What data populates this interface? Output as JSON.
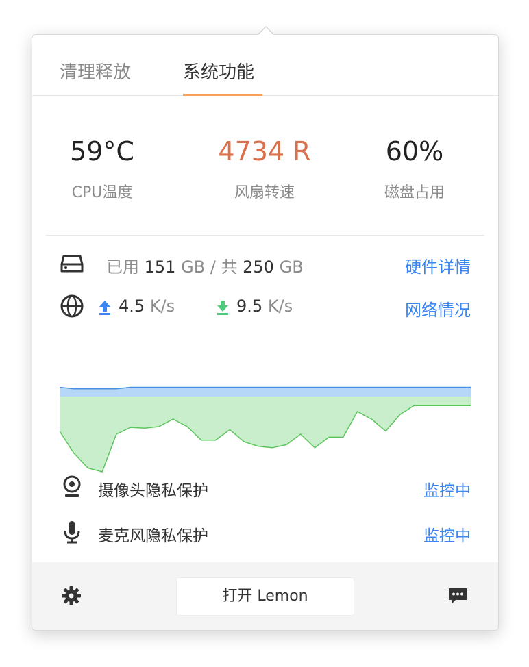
{
  "tabs": [
    {
      "label": "清理释放"
    },
    {
      "label": "系统功能"
    }
  ],
  "stats": {
    "cpu": {
      "value": "59°C",
      "label": "CPU温度"
    },
    "fan": {
      "value": "4734 R",
      "label": "风扇转速"
    },
    "disk": {
      "value": "60%",
      "label": "磁盘占用"
    }
  },
  "storage": {
    "used_prefix": "已用",
    "used_value": "151",
    "unit1": "GB / 共",
    "total_value": "250",
    "unit2": "GB",
    "link": "硬件详情"
  },
  "network": {
    "up_value": "4.5",
    "up_unit": "K/s",
    "down_value": "9.5",
    "down_unit": "K/s",
    "link": "网络情况"
  },
  "privacy": {
    "camera_label": "摄像头隐私保护",
    "camera_status": "监控中",
    "mic_label": "麦克风隐私保护",
    "mic_status": "监控中"
  },
  "footer": {
    "open_button": "打开 Lemon"
  },
  "colors": {
    "accent_orange": "#f4a25b",
    "fan_value": "#d9704b",
    "link_blue": "#3a86f2",
    "upload_blue": "#3a86f2",
    "download_green": "#4fc97a",
    "chart_blue_fill": "#b6d7f7",
    "chart_blue_line": "#4a90e2",
    "chart_green_fill": "#c9eecb",
    "chart_green_line": "#5cc45c"
  },
  "icons": {
    "storage": "hard-drive-icon",
    "network": "globe-icon",
    "upload": "upload-arrow-icon",
    "download": "download-arrow-icon",
    "camera": "webcam-icon",
    "mic": "microphone-icon",
    "settings": "gear-icon",
    "feedback": "chat-bubble-icon"
  },
  "chart_data": {
    "type": "area",
    "series": [
      {
        "values": [
          6,
          5,
          5,
          5,
          5,
          6,
          6,
          6,
          6,
          6,
          6,
          6,
          6,
          6,
          6,
          6,
          6,
          6,
          6,
          6,
          6,
          6,
          6,
          6,
          6,
          6,
          6,
          6,
          6,
          6
        ]
      },
      {
        "values": [
          46,
          75,
          95,
          100,
          50,
          41,
          42,
          40,
          30,
          40,
          58,
          58,
          44,
          60,
          66,
          68,
          64,
          50,
          68,
          54,
          54,
          20,
          30,
          46,
          24,
          12,
          12,
          12,
          12,
          12
        ]
      }
    ]
  }
}
